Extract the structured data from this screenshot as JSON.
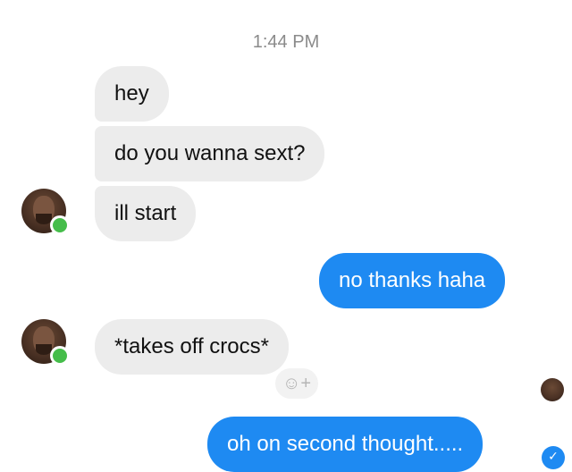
{
  "chat": {
    "timestamp": "1:44 PM",
    "messages": [
      {
        "text": "hey",
        "side": "incoming"
      },
      {
        "text": "do you wanna sext?",
        "side": "incoming"
      },
      {
        "text": "ill start",
        "side": "incoming"
      },
      {
        "text": "no thanks haha",
        "side": "outgoing"
      },
      {
        "text": "*takes off crocs*",
        "side": "incoming"
      },
      {
        "text": "oh on second thought.....",
        "side": "outgoing"
      }
    ],
    "react_icon": "add-reaction-icon",
    "react_glyph": "☺+"
  },
  "colors": {
    "outgoing_bubble": "#1e8af2",
    "incoming_bubble": "#ececec",
    "online_indicator": "#45bd4a",
    "timestamp": "#8b8b8b"
  }
}
